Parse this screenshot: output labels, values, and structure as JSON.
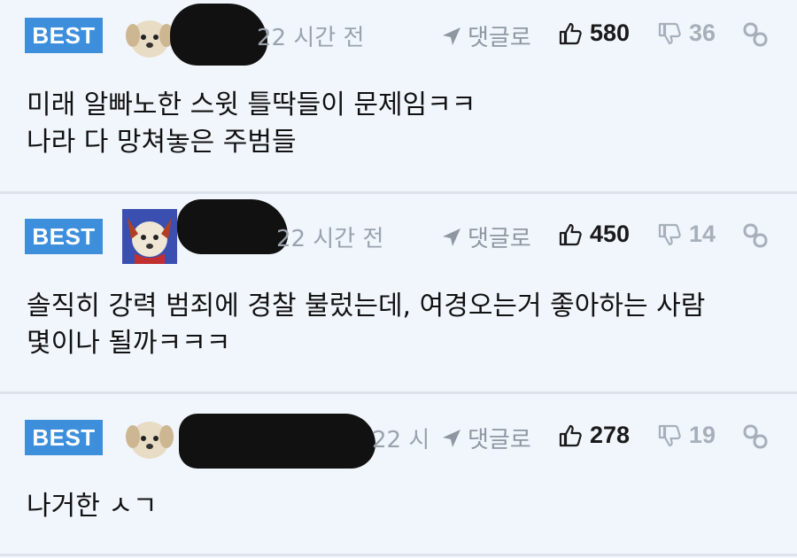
{
  "comments": [
    {
      "badge": "BEST",
      "time": "22 시간 전",
      "reply_label": "댓글로",
      "likes": "580",
      "dislikes": "36",
      "lines": [
        "미래 알빠노한 스윗 틀딱들이 문제임ㅋㅋ",
        "나라 다 망쳐놓은 주범들"
      ]
    },
    {
      "badge": "BEST",
      "time": "22 시간 전",
      "reply_label": "댓글로",
      "likes": "450",
      "dislikes": "14",
      "lines": [
        "솔직히 강력 범죄에 경찰 불렀는데, 여경오는거 좋아하는 사람",
        "몇이나 될까ㅋㅋㅋ"
      ]
    },
    {
      "badge": "BEST",
      "time": "22 시간 전",
      "reply_label": "댓글로",
      "likes": "278",
      "dislikes": "19",
      "lines": [
        "나거한 ㅅㄱ"
      ]
    }
  ],
  "colors": {
    "badge": "#3d8fdc",
    "background": "#f1f6fc",
    "muted": "#9aa3ad"
  },
  "icons": [
    "avatar-dog-icon",
    "reply-arrow-icon",
    "thumbs-up-icon",
    "thumbs-down-icon",
    "link-icon"
  ]
}
